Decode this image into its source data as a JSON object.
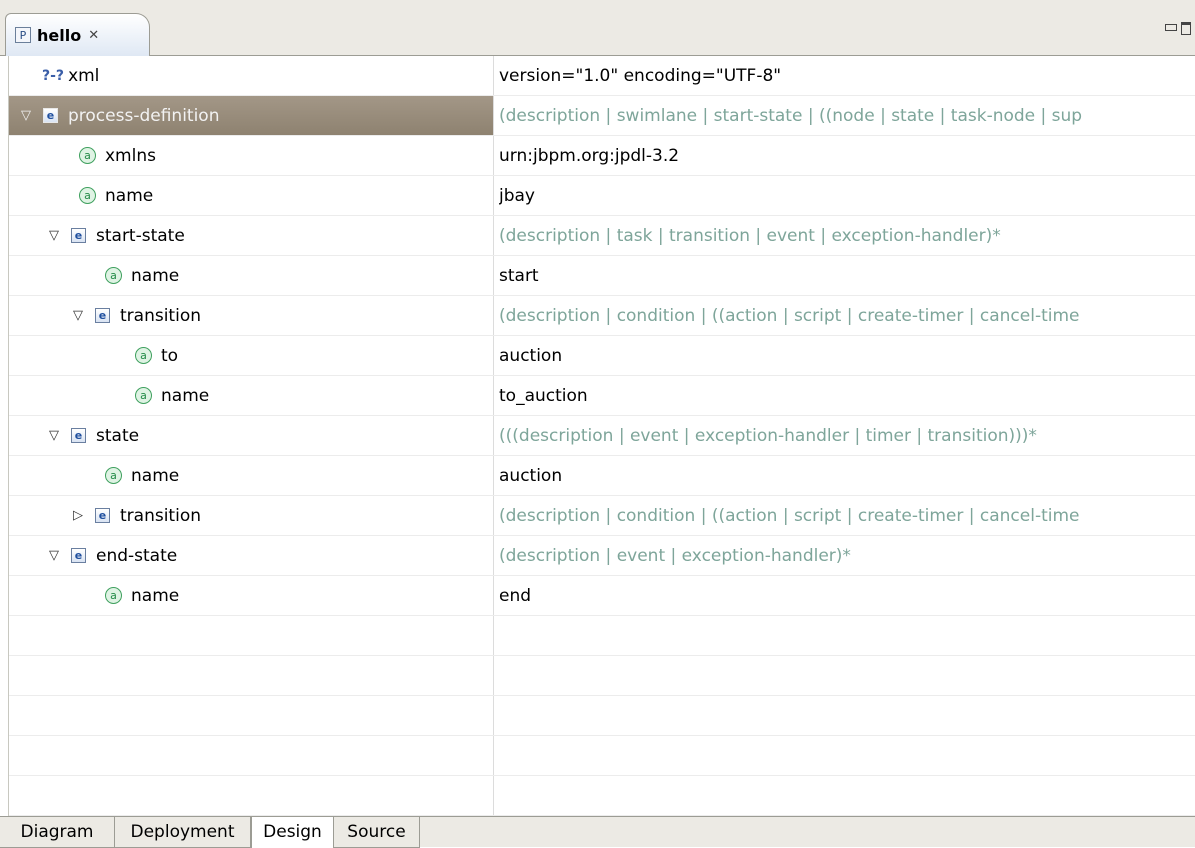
{
  "editor_tab": {
    "icon": "P",
    "title": "hello",
    "close_glyph": "✕"
  },
  "rows": [
    {
      "kind": "pi",
      "twisty": "",
      "icon": "?-?",
      "name": "xml",
      "value": "version=\"1.0\" encoding=\"UTF-8\"",
      "hint": false,
      "selected": false
    },
    {
      "kind": "element",
      "twisty": "▽",
      "icon": "e",
      "name": "process-definition",
      "value": "(description | swimlane | start-state | ((node | state | task-node | sup",
      "hint": true,
      "selected": true
    },
    {
      "kind": "attribute",
      "twisty": "",
      "icon": "a",
      "name": "xmlns",
      "value": "urn:jbpm.org:jpdl-3.2",
      "hint": false,
      "selected": false
    },
    {
      "kind": "attribute",
      "twisty": "",
      "icon": "a",
      "name": "name",
      "value": "jbay",
      "hint": false,
      "selected": false
    },
    {
      "kind": "element",
      "twisty": "▽",
      "icon": "e",
      "name": "start-state",
      "value": "(description | task | transition | event | exception-handler)*",
      "hint": true,
      "selected": false
    },
    {
      "kind": "attribute",
      "twisty": "",
      "icon": "a",
      "name": "name",
      "value": "start",
      "hint": false,
      "selected": false
    },
    {
      "kind": "element",
      "twisty": "▽",
      "icon": "e",
      "name": "transition",
      "value": "(description | condition | ((action | script | create-timer | cancel-time",
      "hint": true,
      "selected": false
    },
    {
      "kind": "attribute",
      "twisty": "",
      "icon": "a",
      "name": "to",
      "value": "auction",
      "hint": false,
      "selected": false
    },
    {
      "kind": "attribute",
      "twisty": "",
      "icon": "a",
      "name": "name",
      "value": "to_auction",
      "hint": false,
      "selected": false
    },
    {
      "kind": "element",
      "twisty": "▽",
      "icon": "e",
      "name": "state",
      "value": "(((description | event | exception-handler | timer | transition)))*",
      "hint": true,
      "selected": false
    },
    {
      "kind": "attribute",
      "twisty": "",
      "icon": "a",
      "name": "name",
      "value": "auction",
      "hint": false,
      "selected": false
    },
    {
      "kind": "element",
      "twisty": "▷",
      "icon": "e",
      "name": "transition",
      "value": "(description | condition | ((action | script | create-timer | cancel-time",
      "hint": true,
      "selected": false
    },
    {
      "kind": "element",
      "twisty": "▽",
      "icon": "e",
      "name": "end-state",
      "value": "(description | event | exception-handler)*",
      "hint": true,
      "selected": false
    },
    {
      "kind": "attribute",
      "twisty": "",
      "icon": "a",
      "name": "name",
      "value": "end",
      "hint": false,
      "selected": false
    }
  ],
  "bottom_tabs": [
    {
      "label": "Diagram",
      "active": false
    },
    {
      "label": "Deployment",
      "active": false
    },
    {
      "label": "Design",
      "active": true
    },
    {
      "label": "Source",
      "active": false
    }
  ],
  "colors": {
    "hint_text": "#7ea59a",
    "selected_row": "#958a79",
    "element_icon": "#1f4f9e",
    "attribute_icon": "#238a47"
  },
  "icons": {
    "element": "element-icon",
    "attribute": "attribute-icon",
    "processing_instruction": "processing-instruction-icon",
    "editor_tab": "process-file-icon"
  }
}
